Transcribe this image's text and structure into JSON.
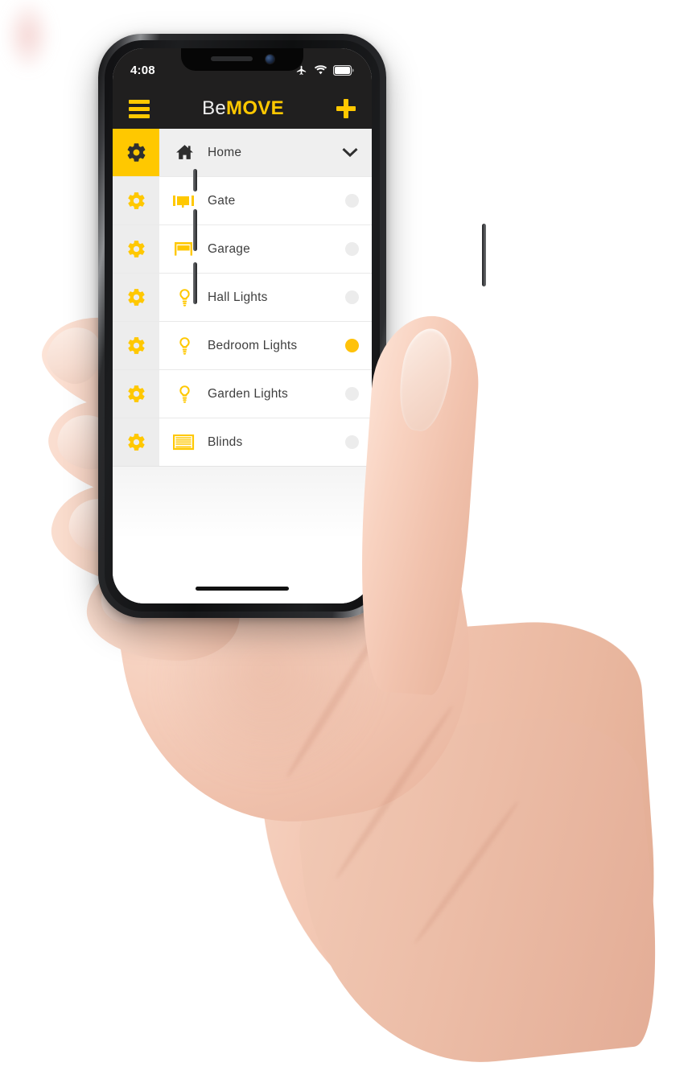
{
  "device": {
    "name": "iphone-x",
    "frame_color": "#17181a",
    "buttons": [
      "silent-switch",
      "volume-up",
      "volume-down",
      "power-button"
    ],
    "home_indicator": true
  },
  "status_bar": {
    "time": "4:08",
    "icons": [
      "airplane-mode-icon",
      "wifi-icon",
      "battery-icon"
    ]
  },
  "app_bar": {
    "menu_icon": "hamburger-menu-icon",
    "title_part1": "Be",
    "title_part2": "MOVE",
    "add_icon": "plus-icon"
  },
  "colors": {
    "accent": "#FFC800",
    "accent_toggle_on": "#FFC20A",
    "bar_background": "#201f1f",
    "gear_strip": "#ededed",
    "header_row": "#efefef",
    "toggle_off": "#ececec",
    "label_text": "#3f3f3f"
  },
  "list": {
    "header": {
      "gear_icon": "gear-icon",
      "icon": "home-icon",
      "label": "Home",
      "chevron": "chevron-down-icon",
      "expanded": true
    },
    "items": [
      {
        "gear_icon": "gear-icon",
        "icon": "gate-icon",
        "label": "Gate",
        "toggle": "off"
      },
      {
        "gear_icon": "gear-icon",
        "icon": "garage-icon",
        "label": "Garage",
        "toggle": "off"
      },
      {
        "gear_icon": "gear-icon",
        "icon": "bulb-icon",
        "label": "Hall Lights",
        "toggle": "off"
      },
      {
        "gear_icon": "gear-icon",
        "icon": "bulb-icon",
        "label": "Bedroom Lights",
        "toggle": "on"
      },
      {
        "gear_icon": "gear-icon",
        "icon": "bulb-icon",
        "label": "Garden Lights",
        "toggle": "off"
      },
      {
        "gear_icon": "gear-icon",
        "icon": "blinds-icon",
        "label": "Blinds",
        "toggle": "off"
      }
    ]
  },
  "scene": {
    "description": "hand-holding-phone",
    "background": "#ffffff"
  }
}
